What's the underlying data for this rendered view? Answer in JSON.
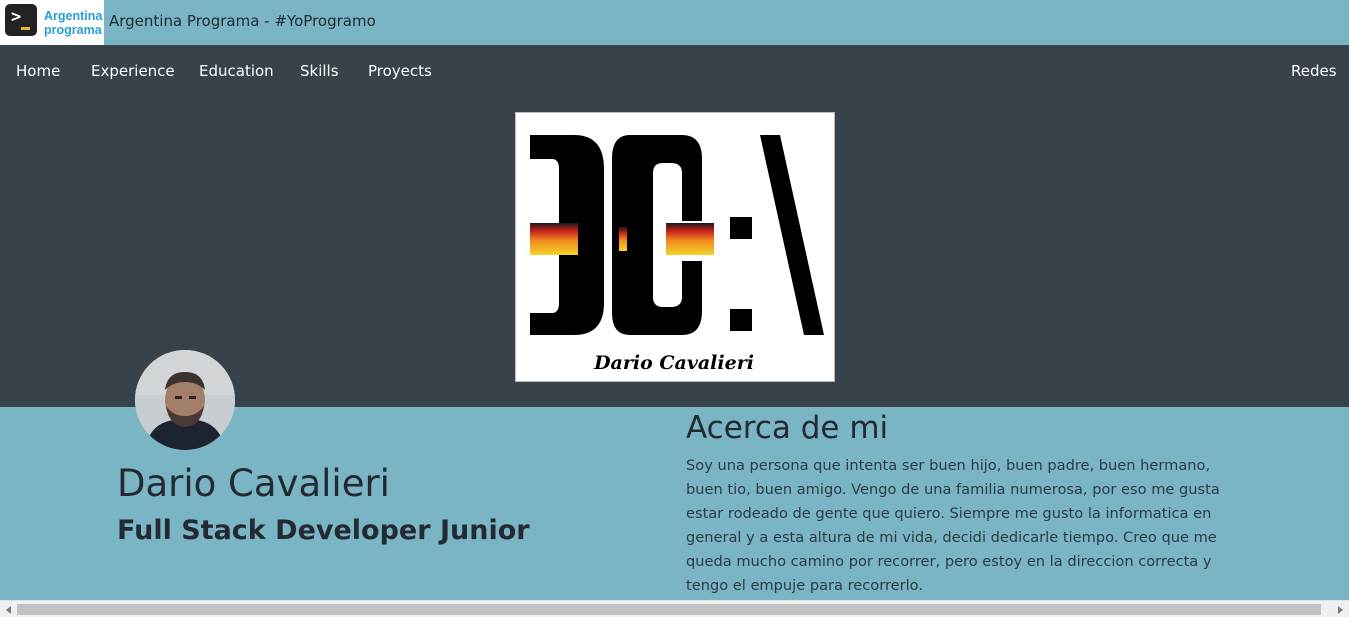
{
  "browser": {
    "logo_line1": "Argentina",
    "logo_line2": "programa",
    "title": "Argentina Programa - #YoProgramo"
  },
  "nav": {
    "items": [
      {
        "label": "Home"
      },
      {
        "label": "Experience"
      },
      {
        "label": "Education"
      },
      {
        "label": "Skills"
      },
      {
        "label": "Proyects"
      }
    ],
    "right_label": "Redes"
  },
  "banner": {
    "logo_text": "DC:\\",
    "signature": "Dario Cavalieri"
  },
  "profile": {
    "name": "Dario Cavalieri",
    "role": "Full Stack Developer Junior"
  },
  "about": {
    "title": "Acerca de mi",
    "text": "Soy una persona que intenta ser buen hijo, buen padre, buen hermano, buen tio, buen amigo. Vengo de una familia numerosa, por eso me gusta estar rodeado de gente que quiero. Siempre me gusto la informatica en general y a esta altura de mi vida, decidi dedicarle tiempo. Creo que me queda mucho camino por recorrer, pero estoy en la direccion correcta y tengo el empuje para recorrerlo."
  },
  "colors": {
    "topbar": "#7ab5c6",
    "navbar": "#37424b",
    "body": "#7ab5c6",
    "text_dark": "#232a31"
  }
}
